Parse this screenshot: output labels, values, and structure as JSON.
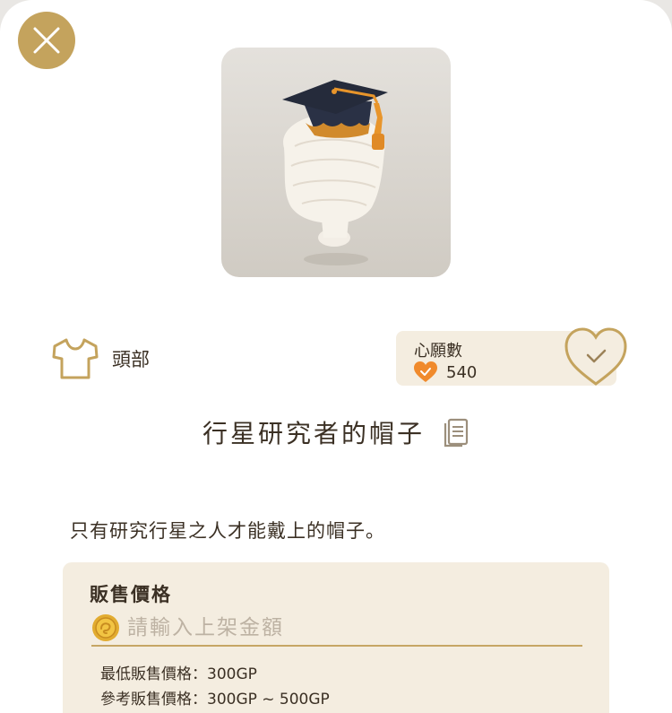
{
  "item": {
    "category": "頭部",
    "name": "行星研究者的帽子",
    "description": "只有研究行星之人才能戴上的帽子。"
  },
  "wishlist": {
    "title": "心願數",
    "count": "540"
  },
  "sale": {
    "title": "販售價格",
    "placeholder": "請輸入上架金額",
    "min_price": "最低販售價格：300GP",
    "ref_price": "參考販售價格：300GP ~ 500GP"
  },
  "icons": {
    "close": "close-icon",
    "category": "shirt-icon",
    "wish_heart": "heart-icon",
    "wish_button": "heart-check-icon",
    "copy": "copy-icon",
    "coin": "coin-icon"
  },
  "colors": {
    "accent_gold": "#c4a35d",
    "card_bg": "#f4ede0",
    "text": "#3b3024",
    "heart_orange": "#f08a2c"
  }
}
